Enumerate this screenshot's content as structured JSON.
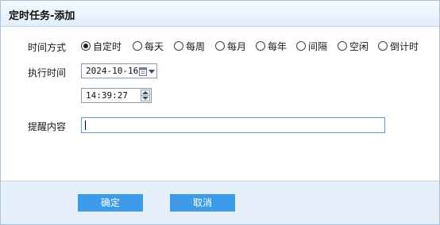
{
  "dialog": {
    "title": "定时任务-添加"
  },
  "form": {
    "mode_label": "时间方式",
    "modes": [
      {
        "label": "自定时",
        "checked": true
      },
      {
        "label": "每天",
        "checked": false
      },
      {
        "label": "每周",
        "checked": false
      },
      {
        "label": "每月",
        "checked": false
      },
      {
        "label": "每年",
        "checked": false
      },
      {
        "label": "间隔",
        "checked": false
      },
      {
        "label": "空闲",
        "checked": false
      },
      {
        "label": "倒计时",
        "checked": false
      }
    ],
    "exec_time_label": "执行时间",
    "date_value": "2024-10-16",
    "time_value": "14:39:27",
    "content_label": "提醒内容",
    "content_value": ""
  },
  "footer": {
    "ok_label": "确定",
    "cancel_label": "取消"
  },
  "colors": {
    "button_bg": "#3d9be8",
    "footer_bg": "#e6f0fa",
    "titlebar_bg": "#e3eef9",
    "focus_border": "#5c9ad2"
  },
  "icons": {
    "date_picker": "calendar-icon",
    "date_dropdown": "chevron-down-icon",
    "time_up": "spin-up-icon",
    "time_down": "spin-down-icon"
  }
}
